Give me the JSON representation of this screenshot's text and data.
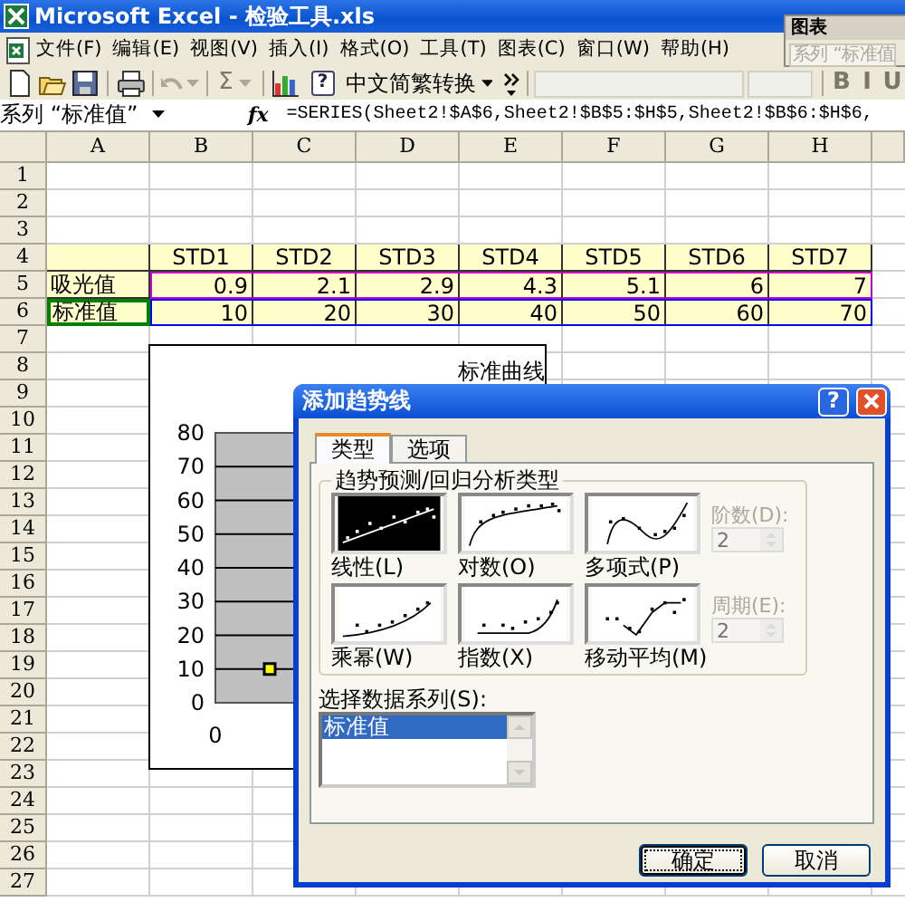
{
  "window": {
    "title": "Microsoft Excel - 检验工具.xls"
  },
  "menu": [
    {
      "label": "文件(F)"
    },
    {
      "label": "编辑(E)"
    },
    {
      "label": "视图(V)"
    },
    {
      "label": "插入(I)"
    },
    {
      "label": "格式(O)"
    },
    {
      "label": "工具(T)"
    },
    {
      "label": "图表(C)"
    },
    {
      "label": "窗口(W)"
    },
    {
      "label": "帮助(H)"
    }
  ],
  "chart_toolbar": {
    "title": "图表",
    "series_box": "系列 “标准值"
  },
  "toolbar": [
    {
      "kind": "new",
      "disabled": false
    },
    {
      "kind": "open",
      "disabled": false
    },
    {
      "kind": "save",
      "disabled": false
    },
    {
      "kind": "print",
      "disabled": false
    },
    {
      "kind": "undo",
      "disabled": true
    },
    {
      "kind": "sum",
      "label": "Σ",
      "disabled": true
    },
    {
      "kind": "chart",
      "disabled": false
    },
    {
      "kind": "help",
      "label": "?",
      "disabled": false
    },
    {
      "kind": "convert",
      "label": "中文简繁转换",
      "disabled": false
    },
    {
      "kind": "more",
      "disabled": false
    },
    {
      "kind": "font_box",
      "disabled": true
    },
    {
      "kind": "size_box",
      "disabled": true
    },
    {
      "kind": "format",
      "label": "B",
      "disabled": true
    },
    {
      "kind": "format",
      "label": "I",
      "disabled": true
    },
    {
      "kind": "format",
      "label": "U",
      "disabled": true
    }
  ],
  "formula_bar": {
    "name_box": "系列 “标准值”",
    "function_label": "fx",
    "formula": "=SERIES(Sheet2!$A$6,Sheet2!$B$5:$H$5,Sheet2!$B$6:$H$6,"
  },
  "sheet": {
    "columns": [
      "A",
      "B",
      "C",
      "D",
      "E",
      "F",
      "G",
      "H"
    ],
    "rows": [
      {
        "header": "1"
      },
      {
        "header": "2"
      },
      {
        "header": "3"
      },
      {
        "header": "4",
        "highlighted": true,
        "kind": "header",
        "cells": {
          "B": "STD1",
          "C": "STD2",
          "D": "STD3",
          "E": "STD4",
          "F": "STD5",
          "G": "STD6",
          "H": "STD7"
        }
      },
      {
        "header": "5",
        "highlighted": true,
        "kind": "values",
        "color": "#cc00cc",
        "cells": {
          "A": "吸光值",
          "B": "0.9",
          "C": "2.1",
          "D": "2.9",
          "E": "4.3",
          "F": "5.1",
          "G": "6",
          "H": "7"
        }
      },
      {
        "header": "6",
        "highlighted": true,
        "kind": "values",
        "color": "#0000ff",
        "label_frame": {
          "color": "#008000"
        },
        "cells": {
          "A": "标准值",
          "B": "10",
          "C": "20",
          "D": "30",
          "E": "40",
          "F": "50",
          "G": "60",
          "H": "70"
        }
      },
      {
        "header": "7"
      },
      {
        "header": "8"
      },
      {
        "header": "9"
      },
      {
        "header": "10"
      },
      {
        "header": "11"
      },
      {
        "header": "12"
      },
      {
        "header": "13"
      },
      {
        "header": "14"
      },
      {
        "header": "15"
      },
      {
        "header": "16"
      },
      {
        "header": "17"
      },
      {
        "header": "18"
      },
      {
        "header": "19"
      },
      {
        "header": "20"
      },
      {
        "header": "21"
      },
      {
        "header": "22"
      },
      {
        "header": "23"
      },
      {
        "header": "24"
      },
      {
        "header": "25"
      },
      {
        "header": "26"
      },
      {
        "header": "27"
      }
    ]
  },
  "chart": {
    "x_axis_label": "0",
    "chart_data": {
      "type": "scatter",
      "title": "标准曲线",
      "grid": true,
      "ylim": [
        0,
        80
      ],
      "yticks": [
        {
          "value": 0,
          "label": "0"
        },
        {
          "value": 10,
          "label": "10"
        },
        {
          "value": 20,
          "label": "20"
        },
        {
          "value": 30,
          "label": "30"
        },
        {
          "value": 40,
          "label": "40"
        },
        {
          "value": 50,
          "label": "50"
        },
        {
          "value": 60,
          "label": "60"
        },
        {
          "value": 70,
          "label": "70"
        },
        {
          "value": 80,
          "label": "80"
        }
      ],
      "series": [
        {
          "color": "#ffff00",
          "values": [
            10
          ]
        }
      ]
    }
  },
  "dialog": {
    "title": "添加趋势线",
    "help_button": "?",
    "tabs": [
      {
        "label": "类型",
        "selected": true
      },
      {
        "label": "选项",
        "selected": false
      }
    ],
    "group_title": "趋势预测/回归分析类型",
    "types": [
      {
        "kind": "linear",
        "label": "线性(L)",
        "selected": true
      },
      {
        "kind": "log",
        "label": "对数(O)",
        "selected": false
      },
      {
        "kind": "poly",
        "label": "多项式(P)",
        "selected": false
      },
      {
        "kind": "power",
        "label": "乘幂(W)",
        "selected": false
      },
      {
        "kind": "exp",
        "label": "指数(X)",
        "selected": false
      },
      {
        "kind": "moving",
        "label": "移动平均(M)",
        "selected": false
      }
    ],
    "order": {
      "label": "阶数(D):",
      "value": "2",
      "disabled": true
    },
    "period": {
      "label": "周期(E):",
      "value": "2",
      "disabled": true
    },
    "series_label": "选择数据系列(S):",
    "series_list": [
      {
        "label": "标准值",
        "selected": true
      }
    ],
    "buttons": [
      {
        "label": "确定",
        "default": true
      },
      {
        "label": "取消",
        "default": false
      }
    ]
  }
}
